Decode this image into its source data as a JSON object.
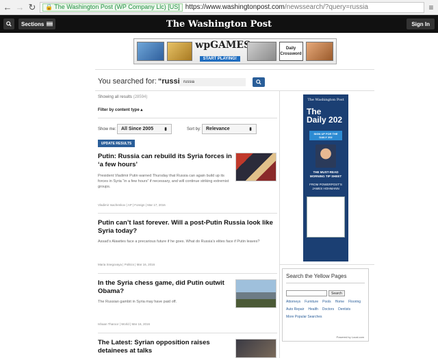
{
  "browser": {
    "cert": "The Washington Post (WP Company Llc) [US]",
    "url_main": "https://www.washingtonpost.com",
    "url_rest": "/newssearch/?query=russia"
  },
  "header": {
    "sections_label": "Sections",
    "logo": "The Washington Post",
    "signin_label": "Sign In"
  },
  "ad": {
    "game1": "",
    "wpgames": "wpGAMES",
    "start": "START PLAYING!",
    "crossword": "Daily Crossword"
  },
  "search": {
    "prefix": "You searched for: ",
    "query_display": "“russia”",
    "input_value": "russia",
    "showing_label": "Showing all results",
    "count": "(28594)",
    "filter_label": "Filter by content type ▴",
    "show_me_label": "Show me:",
    "show_me_value": "All Since 2005",
    "sort_label": "Sort by:",
    "sort_value": "Relevance",
    "update_label": "UPDATE RESULTS"
  },
  "articles": [
    {
      "title": "Putin: Russia can rebuild its Syria forces in ‘a few hours’",
      "desc": "President Vladimir Putin warned Thursday that Russia can again build up its forces in Syria “in a few hours” if necessary, and will continue striking extremist groups.",
      "meta": "Vladimir Isachenkov | AP | Foreign | Mar 17, 2016"
    },
    {
      "title": "Putin can’t last forever. Will a post-Putin Russia look like Syria today?",
      "desc": "Assad’s Alawites face a precarious future if he goes. What do Russia’s elites face if Putin leaves?",
      "meta": "Maria Snegovaya | Politics | Mar 16, 2016"
    },
    {
      "title": "In the Syria chess game, did Putin outwit Obama?",
      "desc": "The Russian gambit in Syria may have paid off.",
      "meta": "Ishaan Tharoor | World | Mar 16, 2016"
    },
    {
      "title": "The Latest: Syrian opposition raises detainees at talks",
      "desc": "",
      "meta": ""
    }
  ],
  "sidebar_ad": {
    "logo": "The Washington Post",
    "title_line1": "The",
    "title_line2": "Daily 202",
    "signup": "SIGN UP FOR THE DAILY 202",
    "tip": "THE MUST-READ MORNING TIP SHEET",
    "from": "FROM POWERPOST’S JAMES HOHMANN"
  },
  "yellow_pages": {
    "title": "Search the Yellow Pages",
    "search_btn": "Search",
    "links": [
      "Attorneys",
      "Furniture",
      "Pools",
      "Home",
      "Flooring",
      "Auto Repair",
      "Health",
      "Doctors",
      "Dentists",
      "More Popular Searches"
    ],
    "footer": "Powered by Local.com"
  }
}
